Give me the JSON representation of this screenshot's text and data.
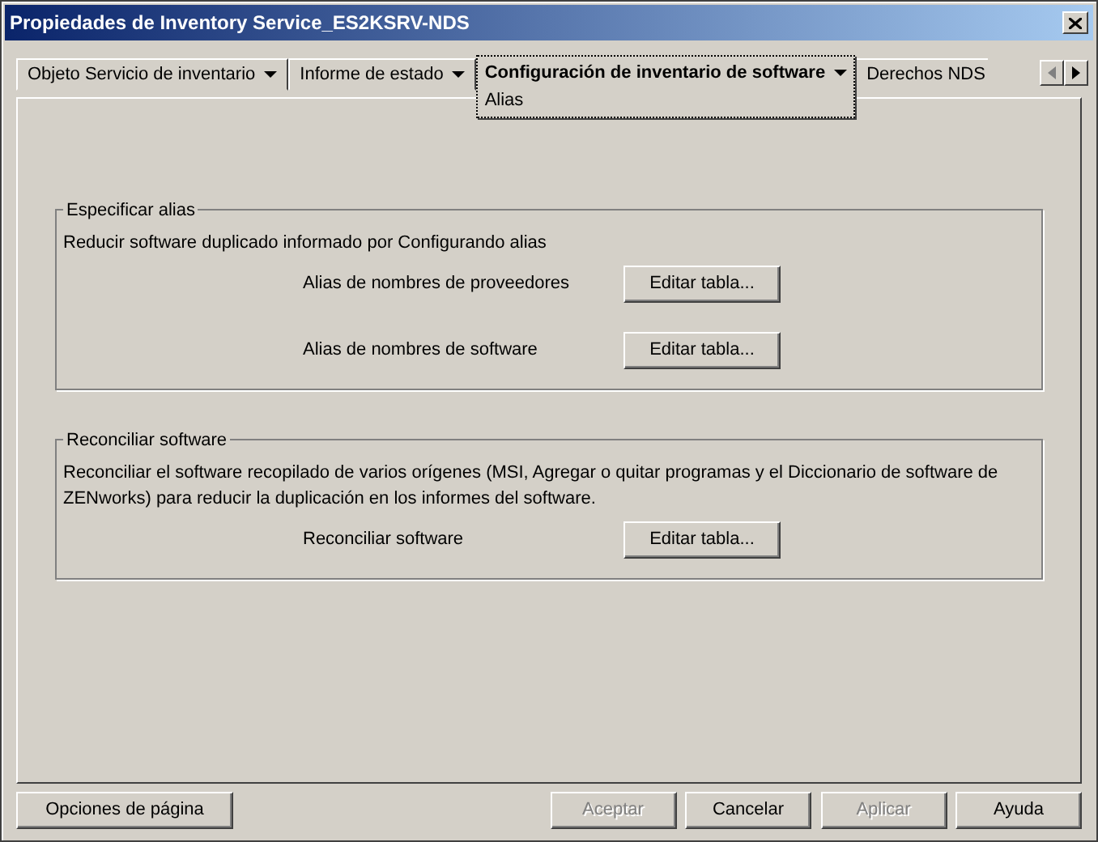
{
  "window": {
    "title": "Propiedades de Inventory Service_ES2KSRV-NDS"
  },
  "tabs": [
    {
      "label": "Objeto Servicio de inventario",
      "selected": false,
      "dropdown": true
    },
    {
      "label": "Informe de estado",
      "selected": false,
      "dropdown": true
    },
    {
      "label": "Configuración de inventario de software",
      "selected": true,
      "dropdown": true,
      "subtab": "Alias"
    },
    {
      "label": "Derechos NDS",
      "selected": false,
      "dropdown": false
    }
  ],
  "tab_scroll": {
    "left_disabled": true,
    "right_disabled": false
  },
  "groups": [
    {
      "legend": "Especificar alias",
      "description": "Reducir software duplicado informado por Configurando alias",
      "rows": [
        {
          "label": "Alias de nombres de proveedores",
          "button": "Editar tabla..."
        },
        {
          "label": "Alias de nombres de software",
          "button": "Editar tabla..."
        }
      ]
    },
    {
      "legend": "Reconciliar software",
      "description": "Reconciliar el software recopilado de varios orígenes (MSI, Agregar o quitar programas y el Diccionario de software de ZENworks) para reducir la duplicación en los informes del software.",
      "rows": [
        {
          "label": "Reconciliar software",
          "button": "Editar tabla..."
        }
      ]
    }
  ],
  "footer_left": {
    "label": "Opciones de página",
    "disabled": false
  },
  "footer_buttons": [
    {
      "label": "Aceptar",
      "disabled": true
    },
    {
      "label": "Cancelar",
      "disabled": false
    },
    {
      "label": "Aplicar",
      "disabled": true
    },
    {
      "label": "Ayuda",
      "disabled": false
    }
  ]
}
